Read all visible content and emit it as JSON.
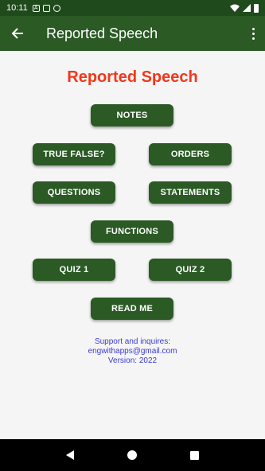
{
  "status_bar": {
    "time": "10:11",
    "icon_a": "A"
  },
  "app_bar": {
    "title": "Reported Speech"
  },
  "main": {
    "title": "Reported Speech",
    "buttons": {
      "notes": "NOTES",
      "true_false": "TRUE FALSE?",
      "orders": "ORDERS",
      "questions": "QUESTIONS",
      "statements": "STATEMENTS",
      "functions": "FUNCTIONS",
      "quiz1": "QUIZ 1",
      "quiz2": "QUIZ 2",
      "read_me": "READ ME"
    },
    "info": {
      "line1": "Support and inquires:",
      "line2": "engwithapps@gmail.com",
      "line3": "Version: 2022"
    }
  },
  "colors": {
    "app_bar": "#2b5a25",
    "title": "#f2371b",
    "info": "#3b3bd4"
  }
}
